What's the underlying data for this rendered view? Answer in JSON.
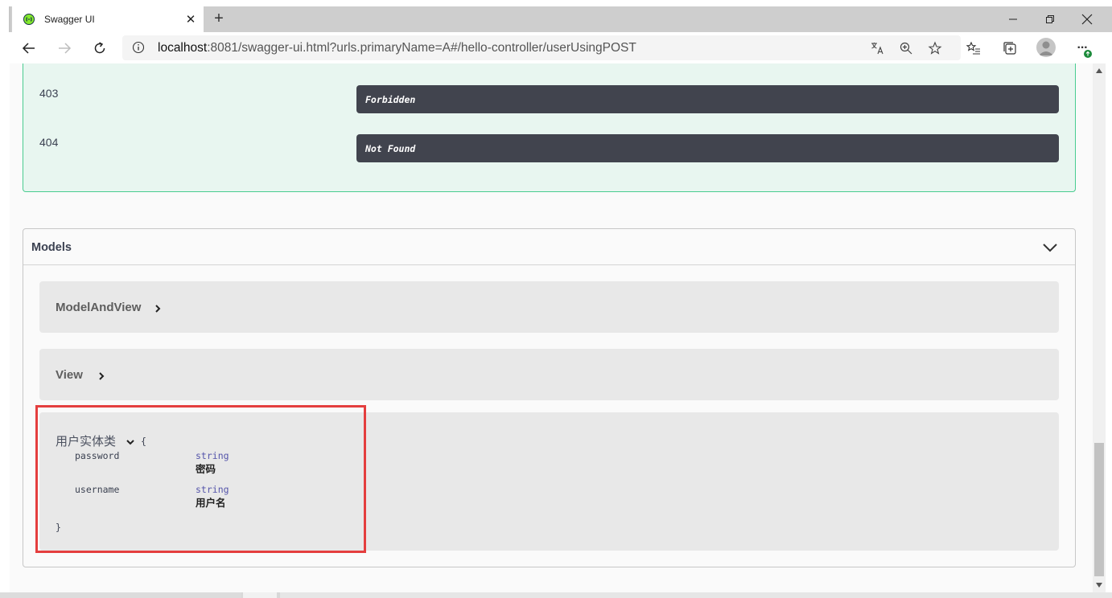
{
  "browser": {
    "tab_title": "Swagger UI",
    "tab_close": "✕",
    "new_tab": "+",
    "url_host": "localhost",
    "url_rest": ":8081/swagger-ui.html?urls.primaryName=A#/hello-controller/userUsingPOST",
    "more_menu": "···"
  },
  "responses": [
    {
      "code": "403",
      "description": "Forbidden"
    },
    {
      "code": "404",
      "description": "Not Found"
    }
  ],
  "models": {
    "title": "Models",
    "items": [
      {
        "name": "ModelAndView"
      },
      {
        "name": "View"
      }
    ],
    "user_entity": {
      "name": "用户实体类",
      "open_brace": "{",
      "close_brace": "}",
      "properties": [
        {
          "name": "password",
          "type": "string",
          "description": "密码"
        },
        {
          "name": "username",
          "type": "string",
          "description": "用户名"
        }
      ]
    }
  },
  "colors": {
    "response_bg": "#e8f6f0",
    "response_border": "#49cc90",
    "desc_bg": "#41444e",
    "model_bg": "#e8e8e8",
    "highlight": "#e43e3e",
    "type_color": "#5555aa"
  }
}
